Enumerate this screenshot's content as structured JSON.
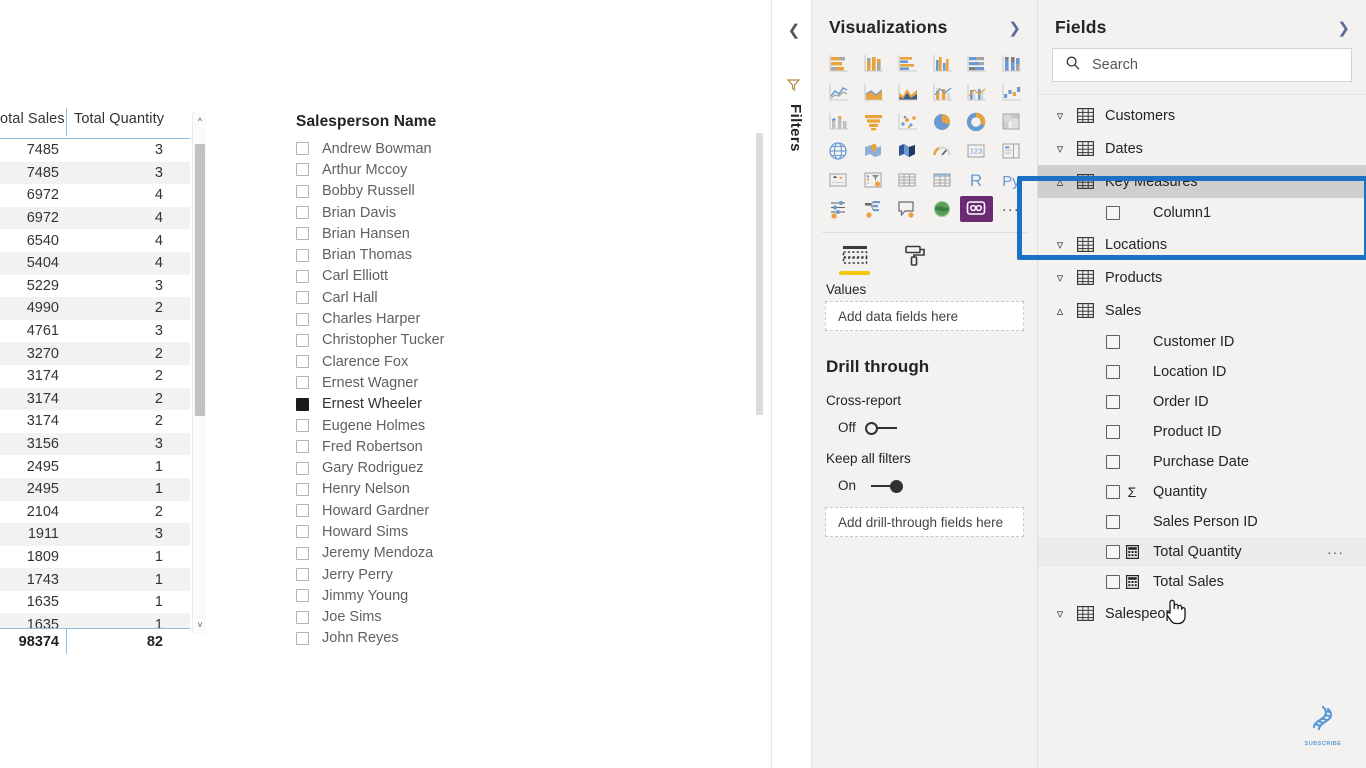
{
  "table_visual": {
    "columns": [
      "otal Sales",
      "Total Quantity"
    ],
    "rows": [
      {
        "sales": "7485",
        "qty": "3"
      },
      {
        "sales": "7485",
        "qty": "3"
      },
      {
        "sales": "6972",
        "qty": "4"
      },
      {
        "sales": "6972",
        "qty": "4"
      },
      {
        "sales": "6540",
        "qty": "4"
      },
      {
        "sales": "5404",
        "qty": "4"
      },
      {
        "sales": "5229",
        "qty": "3"
      },
      {
        "sales": "4990",
        "qty": "2"
      },
      {
        "sales": "4761",
        "qty": "3"
      },
      {
        "sales": "3270",
        "qty": "2"
      },
      {
        "sales": "3174",
        "qty": "2"
      },
      {
        "sales": "3174",
        "qty": "2"
      },
      {
        "sales": "3174",
        "qty": "2"
      },
      {
        "sales": "3156",
        "qty": "3"
      },
      {
        "sales": "2495",
        "qty": "1"
      },
      {
        "sales": "2495",
        "qty": "1"
      },
      {
        "sales": "2104",
        "qty": "2"
      },
      {
        "sales": "1911",
        "qty": "3"
      },
      {
        "sales": "1809",
        "qty": "1"
      },
      {
        "sales": "1743",
        "qty": "1"
      },
      {
        "sales": "1635",
        "qty": "1"
      },
      {
        "sales": "1635",
        "qty": "1"
      }
    ],
    "total": {
      "sales": "98374",
      "qty": "82"
    }
  },
  "slicer": {
    "title": "Salesperson Name",
    "items": [
      {
        "label": "Andrew Bowman",
        "checked": false
      },
      {
        "label": "Arthur Mccoy",
        "checked": false
      },
      {
        "label": "Bobby Russell",
        "checked": false
      },
      {
        "label": "Brian Davis",
        "checked": false
      },
      {
        "label": "Brian Hansen",
        "checked": false
      },
      {
        "label": "Brian Thomas",
        "checked": false
      },
      {
        "label": "Carl Elliott",
        "checked": false
      },
      {
        "label": "Carl Hall",
        "checked": false
      },
      {
        "label": "Charles Harper",
        "checked": false
      },
      {
        "label": "Christopher Tucker",
        "checked": false
      },
      {
        "label": "Clarence Fox",
        "checked": false
      },
      {
        "label": "Ernest Wagner",
        "checked": false
      },
      {
        "label": "Ernest Wheeler",
        "checked": true
      },
      {
        "label": "Eugene Holmes",
        "checked": false
      },
      {
        "label": "Fred Robertson",
        "checked": false
      },
      {
        "label": "Gary Rodriguez",
        "checked": false
      },
      {
        "label": "Henry Nelson",
        "checked": false
      },
      {
        "label": "Howard Gardner",
        "checked": false
      },
      {
        "label": "Howard Sims",
        "checked": false
      },
      {
        "label": "Jeremy Mendoza",
        "checked": false
      },
      {
        "label": "Jerry Perry",
        "checked": false
      },
      {
        "label": "Jimmy Young",
        "checked": false
      },
      {
        "label": "Joe Sims",
        "checked": false
      },
      {
        "label": "John Reyes",
        "checked": false
      }
    ]
  },
  "filters_rail": {
    "label": "Filters",
    "collapse_icon": "chevron-left-icon",
    "funnel_icon": "filter-funnel-icon"
  },
  "visualizations": {
    "title": "Visualizations",
    "expand_icon": "chevron-right-icon",
    "icons": [
      "stacked-bar-chart",
      "stacked-column-chart",
      "clustered-bar-chart",
      "clustered-column-chart",
      "hundred-percent-stacked-bar-chart",
      "hundred-percent-stacked-column-chart",
      "line-chart",
      "area-chart",
      "stacked-area-chart",
      "line-stacked-column-chart",
      "line-clustered-column-chart",
      "waterfall-chart",
      "ribbon-chart",
      "funnel-chart",
      "scatter-chart",
      "pie-chart",
      "donut-chart",
      "treemap-chart",
      "map-visual",
      "filled-map-visual",
      "shape-map-visual",
      "gauge-visual",
      "card-visual",
      "multi-row-card-visual",
      "kpi-visual",
      "slicer-visual",
      "table-visual",
      "matrix-visual",
      "r-script-visual",
      "python-visual",
      "key-influencers-visual",
      "decomposition-tree-visual",
      "qna-visual",
      "arcgis-map-visual",
      "paginated-report-visual",
      "more-options"
    ],
    "selected_icon_index": 34,
    "tabs": [
      {
        "name": "fields-tab",
        "icon": "fields-table-icon",
        "active": true
      },
      {
        "name": "format-tab",
        "icon": "paint-roller-icon",
        "active": false
      }
    ],
    "values_label": "Values",
    "values_placeholder": "Add data fields here",
    "drill_through": {
      "title": "Drill through",
      "cross_report_label": "Cross-report",
      "cross_report_state": "Off",
      "keep_filters_label": "Keep all filters",
      "keep_filters_state": "On",
      "drill_placeholder": "Add drill-through fields here"
    }
  },
  "fields": {
    "title": "Fields",
    "expand_icon": "chevron-right-icon",
    "search_placeholder": "Search",
    "search_icon": "search-icon",
    "tree": [
      {
        "name": "Customers",
        "expanded": false,
        "highlighted": false,
        "children": []
      },
      {
        "name": "Dates",
        "expanded": false,
        "highlighted": false,
        "children": []
      },
      {
        "name": "Key Measures",
        "expanded": true,
        "highlighted": true,
        "children": [
          {
            "name": "Column1",
            "kind": "column"
          }
        ]
      },
      {
        "name": "Locations",
        "expanded": false,
        "highlighted": false,
        "children": []
      },
      {
        "name": "Products",
        "expanded": false,
        "highlighted": false,
        "children": []
      },
      {
        "name": "Sales",
        "expanded": true,
        "highlighted": false,
        "children": [
          {
            "name": "Customer ID",
            "kind": "column"
          },
          {
            "name": "Location ID",
            "kind": "column"
          },
          {
            "name": "Order ID",
            "kind": "column"
          },
          {
            "name": "Product ID",
            "kind": "column"
          },
          {
            "name": "Purchase Date",
            "kind": "column"
          },
          {
            "name": "Quantity",
            "kind": "sum"
          },
          {
            "name": "Sales Person ID",
            "kind": "column"
          },
          {
            "name": "Total Quantity",
            "kind": "measure",
            "hover": true,
            "menu": "···"
          },
          {
            "name": "Total Sales",
            "kind": "measure"
          }
        ]
      },
      {
        "name": "Salespeople",
        "expanded": false,
        "highlighted": false,
        "children": []
      }
    ],
    "highlight_color": "#1b72c4"
  },
  "watermark": {
    "text": "SUBSCRIBE",
    "icon": "dna-helix-icon",
    "color": "#5b9bd5"
  }
}
